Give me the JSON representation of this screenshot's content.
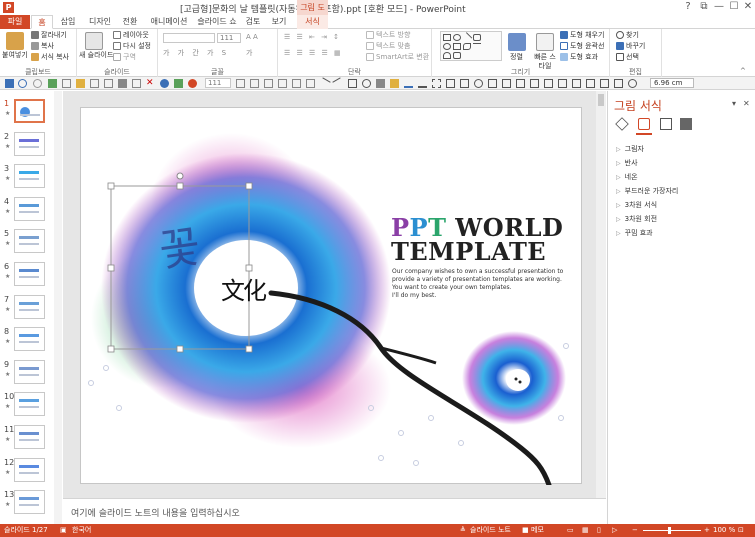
{
  "window": {
    "title": "[고급형]문화의 날 템플릿(자동완성형 포함).ppt [호환 모드] - PowerPoint",
    "context_tab_group": "그림 도구",
    "controls": [
      "?",
      "⧉",
      "—",
      "☐",
      "✕"
    ]
  },
  "tabs": {
    "file": "파일",
    "items": [
      "홈",
      "삽입",
      "디자인",
      "전환",
      "애니메이션",
      "슬라이드 쇼",
      "검토",
      "보기"
    ],
    "context": "서식",
    "active": "홈"
  },
  "ribbon": {
    "clipboard": {
      "label": "클립보드",
      "paste": "붙여넣기",
      "cut": "잘라내기",
      "copy": "복사",
      "format_painter": "서식 복사"
    },
    "slides": {
      "label": "슬라이드",
      "new_slide": "새 슬라이드",
      "layout": "레이아웃",
      "reset": "다시 설정",
      "section": "구역"
    },
    "font": {
      "label": "글꼴",
      "size": "111"
    },
    "paragraph": {
      "label": "단락",
      "text_direction": "텍스트 방향",
      "align_text": "텍스트 맞춤",
      "smartart": "SmartArt로 변환"
    },
    "drawing": {
      "label": "그리기",
      "arrange": "정렬",
      "quick_styles": "빠른 스타일",
      "fill": "도형 채우기",
      "outline": "도형 윤곽선",
      "effects": "도형 효과"
    },
    "editing": {
      "label": "편집",
      "find": "찾기",
      "replace": "바꾸기",
      "select": "선택"
    }
  },
  "qat": {
    "size_value": "6.96 cm",
    "font_size": "111"
  },
  "thumbnails": [
    "1",
    "2",
    "3",
    "4",
    "5",
    "6",
    "7",
    "8",
    "9",
    "10",
    "11",
    "12",
    "13"
  ],
  "slide": {
    "title_line1": [
      "P",
      "P",
      "T",
      " WORLD"
    ],
    "title_line2": "TEMPLATE",
    "title_colors": [
      "#8a3fa6",
      "#2b8fd1",
      "#2ba56c",
      "#222222"
    ],
    "body": [
      "Our company wishes to own a successful presentation to",
      "provide a variety of presentation templates are working.",
      "You want to create your own templates.",
      "I'll do my best."
    ],
    "calligraphy_left": "꽃",
    "calligraphy_center": "文化"
  },
  "notes_placeholder": "여기에 슬라이드 노트의 내용을 입력하십시오",
  "pane": {
    "title": "그림 서식",
    "items": [
      "그림자",
      "반사",
      "네온",
      "부드러운 가장자리",
      "3차원 서식",
      "3차원 회전",
      "꾸밈 효과"
    ]
  },
  "status": {
    "slide": "슬라이드 1/27",
    "language": "한국어",
    "notes": "슬라이드 노트",
    "comments": "메모",
    "zoom": "100 %"
  }
}
